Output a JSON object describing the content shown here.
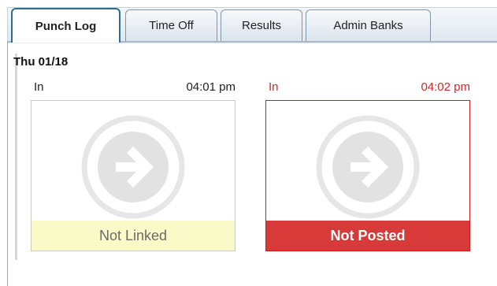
{
  "tabs": [
    {
      "label": "Punch Log",
      "active": true
    },
    {
      "label": "Time Off",
      "active": false
    },
    {
      "label": "Results",
      "active": false
    },
    {
      "label": "Admin Banks",
      "active": false
    }
  ],
  "day": {
    "title": "Thu 01/18",
    "punches": [
      {
        "direction": "In",
        "time": "04:01 pm",
        "status": "Not Linked",
        "icon": "arrow-right-circle-icon"
      },
      {
        "direction": "In",
        "time": "04:02 pm",
        "status": "Not Posted",
        "icon": "arrow-right-circle-icon"
      }
    ]
  },
  "colors": {
    "tab_border_active": "#2f6b93",
    "error_text": "#cc2a2a",
    "error_bar": "#d83a3a",
    "warn_bar": "#fafac8"
  }
}
